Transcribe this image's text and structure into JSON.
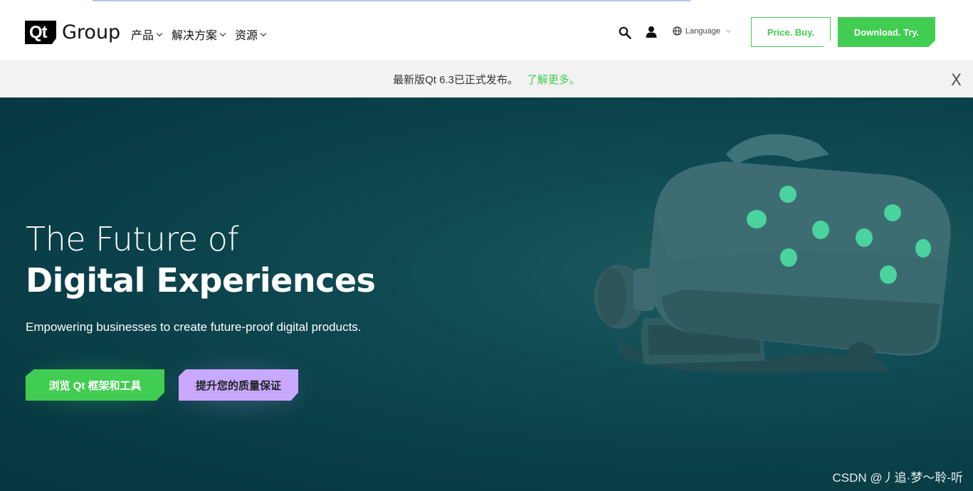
{
  "header": {
    "logo_mark": "Qt",
    "logo_word": "Group",
    "nav": [
      {
        "label": "产品"
      },
      {
        "label": "解决方案"
      },
      {
        "label": "资源"
      }
    ],
    "language_label": "Language",
    "price_button": "Price. Buy.",
    "download_button": "Download. Try."
  },
  "banner": {
    "text": "最新版Qt 6.3已正式发布。",
    "link": "了解更多。",
    "close": "X"
  },
  "hero": {
    "title_line1": "The Future of",
    "title_line2": "Digital Experiences",
    "subtitle": "Empowering businesses to create future-proof digital products.",
    "cta_primary": "浏览 Qt 框架和工具",
    "cta_secondary": "提升您的质量保证"
  },
  "watermark": "CSDN @丿追·梦～聆-听",
  "colors": {
    "accent_green": "#41cd52",
    "accent_purple": "#c8a9ff",
    "hero_bg": "#0a3f48"
  },
  "icons": [
    "search-icon",
    "user-icon",
    "globe-icon",
    "chevron-down-icon",
    "close-icon"
  ]
}
